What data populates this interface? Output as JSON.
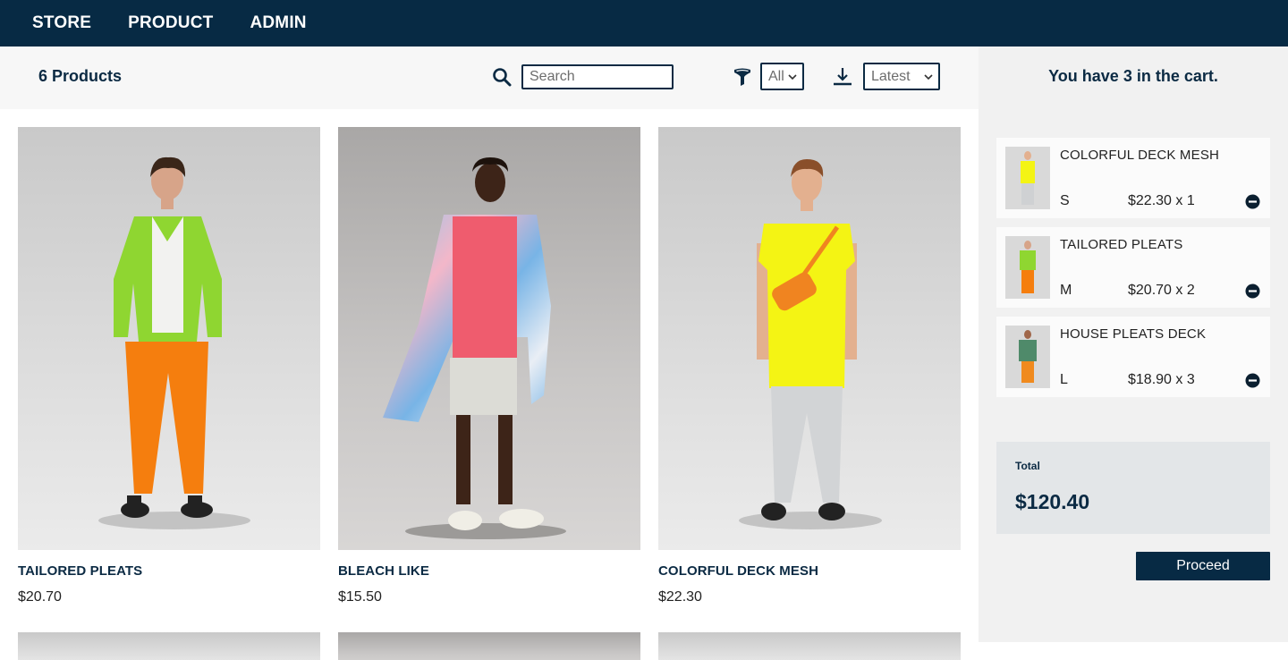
{
  "nav": {
    "items": [
      "STORE",
      "PRODUCT",
      "ADMIN"
    ]
  },
  "filters": {
    "count_label": "6 Products",
    "search_placeholder": "Search",
    "size_selected": "All",
    "sort_selected": "Latest",
    "icons": [
      "search-icon",
      "filter-icon",
      "sort-icon",
      "chevron-down-icon"
    ]
  },
  "products": [
    {
      "name": "TAILORED PLEATS",
      "price": "$20.70"
    },
    {
      "name": "BLEACH LIKE",
      "price": "$15.50"
    },
    {
      "name": "COLORFUL DECK MESH",
      "price": "$22.30"
    }
  ],
  "cart": {
    "title": "You have 3 in the cart.",
    "items": [
      {
        "name": "COLORFUL DECK MESH",
        "size": "S",
        "price_qty": "$22.30 x 1"
      },
      {
        "name": "TAILORED PLEATS",
        "size": "M",
        "price_qty": "$20.70 x 2"
      },
      {
        "name": "HOUSE PLEATS DECK",
        "size": "L",
        "price_qty": "$18.90 x 3"
      }
    ],
    "total_label": "Total",
    "total_value": "$120.40",
    "proceed_label": "Proceed"
  },
  "colors": {
    "navy": "#072a44",
    "text_dark": "#0b2a43",
    "sidebar_bg": "#f1f1f1",
    "filterbar_bg": "#f7f7f7",
    "total_bg": "#e3e6e8"
  }
}
